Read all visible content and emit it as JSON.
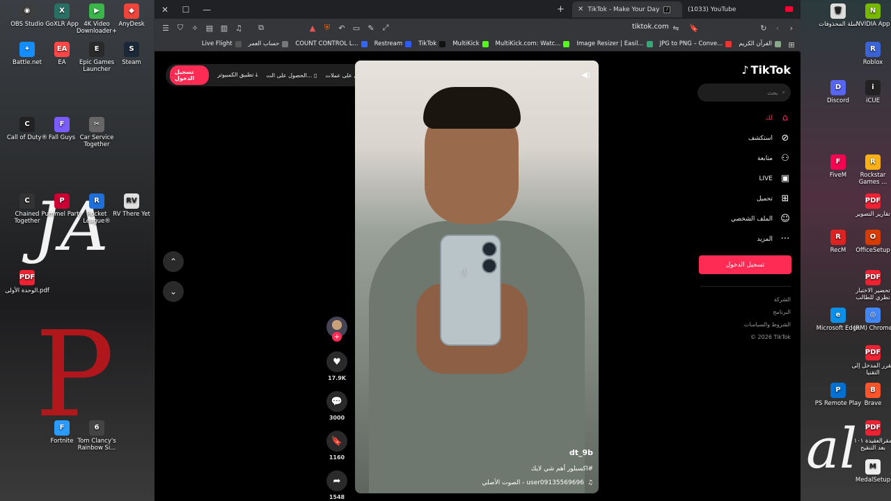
{
  "desktop": {
    "left_icons": [
      {
        "label": "OBS Studio",
        "color": "#3d3d3d",
        "glyph": "◉"
      },
      {
        "label": "GoXLR App",
        "color": "#2a6f64",
        "glyph": "X"
      },
      {
        "label": "4K Video Downloader+",
        "color": "#39b54a",
        "glyph": "▶"
      },
      {
        "label": "AnyDesk",
        "color": "#ef443b",
        "glyph": "◆"
      },
      {
        "label": "Battle.net",
        "color": "#148eff",
        "glyph": "✦"
      },
      {
        "label": "EA",
        "color": "#ff4747",
        "glyph": "EA"
      },
      {
        "label": "Epic Games Launcher",
        "color": "#2a2a2a",
        "glyph": "E"
      },
      {
        "label": "Steam",
        "color": "#1b2838",
        "glyph": "S"
      },
      {
        "label": "Call of Duty®",
        "color": "#222",
        "glyph": "C"
      },
      {
        "label": "Fall Guys",
        "color": "#7b5cff",
        "glyph": "F"
      },
      {
        "label": "Car Service Together",
        "color": "#666",
        "glyph": "✂"
      },
      {
        "label": "Chained Together",
        "color": "#333",
        "glyph": "C"
      },
      {
        "label": "Pummel Party",
        "color": "#c03",
        "glyph": "P"
      },
      {
        "label": "Rocket League®",
        "color": "#1e6fd9",
        "glyph": "R"
      },
      {
        "label": "RV There Yet",
        "color": "#e0e0e0",
        "glyph": "RV"
      },
      {
        "label": "الوحدة الأولى.pdf",
        "color": "#e23",
        "glyph": "PDF"
      },
      {
        "label": "Fortnite",
        "color": "#2b9cff",
        "glyph": "F"
      },
      {
        "label": "Tom Clancy's Rainbow Si...",
        "color": "#444",
        "glyph": "6"
      }
    ],
    "right_icons": [
      {
        "label": "سلة المحذوفات",
        "color": "#ddd",
        "glyph": "🗑"
      },
      {
        "label": "NVIDIA App",
        "color": "#76b900",
        "glyph": "N"
      },
      {
        "label": "Roblox",
        "color": "#3a63d4",
        "glyph": "R"
      },
      {
        "label": "Discord",
        "color": "#5865f2",
        "glyph": "D"
      },
      {
        "label": "iCUE",
        "color": "#222",
        "glyph": "i"
      },
      {
        "label": "FiveM",
        "color": "#f40552",
        "glyph": "F"
      },
      {
        "label": "Rockstar Games ...",
        "color": "#fcaf17",
        "glyph": "R"
      },
      {
        "label": "تقارير التصوير",
        "color": "#e23",
        "glyph": "PDF"
      },
      {
        "label": "RecM",
        "color": "#d22",
        "glyph": "R"
      },
      {
        "label": "OfficeSetup",
        "color": "#d83b01",
        "glyph": "O"
      },
      {
        "label": "تحضير الاختبار نظري للطالب",
        "color": "#e23",
        "glyph": "PDF"
      },
      {
        "label": "Microsoft Edge",
        "color": "#0c8fe8",
        "glyph": "e"
      },
      {
        "label": "(RM) Chrome",
        "color": "#4285f4",
        "glyph": "◎"
      },
      {
        "label": "مقرر المدخل إلى التقنيا",
        "color": "#e23",
        "glyph": "PDF"
      },
      {
        "label": "PS Remote Play",
        "color": "#0070d1",
        "glyph": "P"
      },
      {
        "label": "Brave",
        "color": "#fb542b",
        "glyph": "B"
      },
      {
        "label": "مقرالعقيدة ١٠١ بعد التنقيح",
        "color": "#e23",
        "glyph": "PDF"
      },
      {
        "label": "MedalSetup",
        "color": "#eee",
        "glyph": "M"
      }
    ],
    "wallpaper_text_left": "JA",
    "wallpaper_text_left2": "P",
    "wallpaper_text_right": "al"
  },
  "browser": {
    "tabs": [
      {
        "title": "TikTok - Make Your Day",
        "active": true
      },
      {
        "title": "(1033) YouTube",
        "active": false
      }
    ],
    "url": "tiktok.com",
    "bookmarks": [
      {
        "label": "Live Flight",
        "color": "#555"
      },
      {
        "label": "حساب العمر",
        "color": "#777"
      },
      {
        "label": "COUNT CONTROL L...",
        "color": "#3366ff"
      },
      {
        "label": "Restream",
        "color": "#2d5bff"
      },
      {
        "label": "TikTok",
        "color": "#111"
      },
      {
        "label": "MultiKick",
        "color": "#53fc18"
      },
      {
        "label": "MultiKick.com: Watc...",
        "color": "#53fc18"
      },
      {
        "label": "Image Resizer | Easil...",
        "color": "#3a7"
      },
      {
        "label": "JPG to PNG – Conve...",
        "color": "#e33"
      },
      {
        "label": "القرآن الكريم",
        "color": "#8a8"
      }
    ]
  },
  "tiktok": {
    "topbar": {
      "signin": "تسجيل الدخول",
      "desktop_app": "تطبيق الكمبيوتر",
      "get_app": "الحصول على الت...",
      "coins": "احصل على عملات"
    },
    "logo": "TikTok",
    "search_placeholder": "بحث",
    "menu": [
      {
        "label": "لك",
        "icon": "⌂",
        "name": "home"
      },
      {
        "label": "استكشف",
        "icon": "⊘",
        "name": "explore"
      },
      {
        "label": "متابعة",
        "icon": "⚇",
        "name": "following"
      },
      {
        "label": "LIVE",
        "icon": "▣",
        "name": "live"
      },
      {
        "label": "تحميل",
        "icon": "⊞",
        "name": "upload"
      },
      {
        "label": "الملف الشخصي",
        "icon": "☺",
        "name": "profile"
      },
      {
        "label": "المزيد",
        "icon": "···",
        "name": "more"
      }
    ],
    "signin_button": "تسجيل الدخول",
    "footer": [
      "الشركة",
      "البرنامج",
      "الشروط والسياسات",
      "© 2026 TikTok"
    ],
    "video": {
      "username": "dt_9b",
      "caption": "#اكسبلور أهم شي لايك",
      "music": "الصوت الأصلي - user09135569696"
    },
    "actions": {
      "likes": "17.9K",
      "comments": "3000",
      "saves": "1160",
      "shares": "1548"
    }
  }
}
